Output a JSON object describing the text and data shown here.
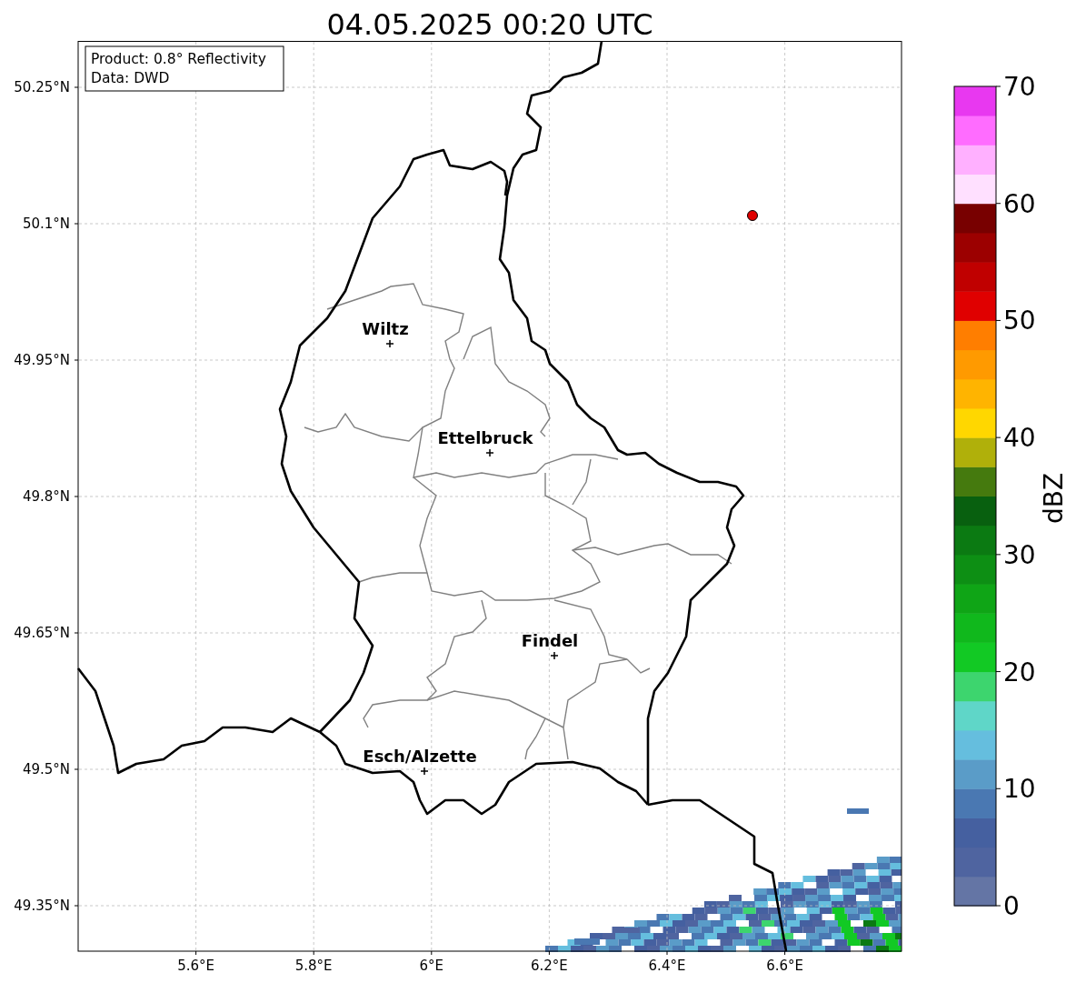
{
  "title": "04.05.2025 00:20 UTC",
  "info_box": [
    "Product: 0.8° Reflectivity",
    "Data: DWD"
  ],
  "map": {
    "lat_ticks": [
      "50.25°N",
      "50.1°N",
      "49.95°N",
      "49.8°N",
      "49.65°N",
      "49.5°N",
      "49.35°N"
    ],
    "lon_ticks": [
      "5.6°E",
      "5.8°E",
      "6°E",
      "6.2°E",
      "6.4°E",
      "6.6°E"
    ],
    "cities": [
      {
        "name": "Wiltz"
      },
      {
        "name": "Ettelbruck"
      },
      {
        "name": "Findel"
      },
      {
        "name": "Esch/Alzette"
      }
    ]
  },
  "colorbar": {
    "label": "dBZ",
    "ticks": [
      "70",
      "60",
      "50",
      "40",
      "30",
      "20",
      "10",
      "0"
    ]
  }
}
